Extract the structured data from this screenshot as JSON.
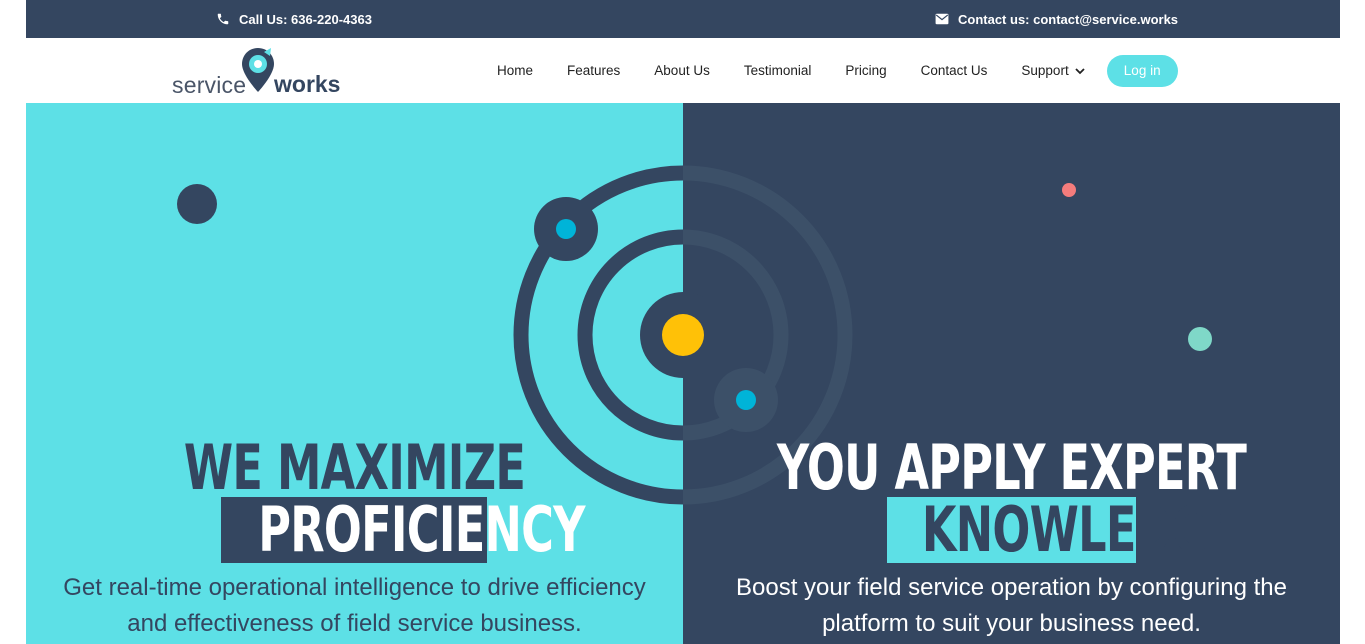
{
  "topbar": {
    "call_label": "Call Us: 636-220-4363",
    "contact_label": "Contact us: contact@service.works",
    "phone_icon": "phone-icon",
    "mail_icon": "envelope-icon"
  },
  "logo": {
    "word1": "service",
    "word2": "works",
    "icon": "map-pin-icon"
  },
  "nav": {
    "items": [
      {
        "label": "Home"
      },
      {
        "label": "Features"
      },
      {
        "label": "About Us"
      },
      {
        "label": "Testimonial"
      },
      {
        "label": "Pricing"
      },
      {
        "label": "Contact Us"
      },
      {
        "label": "Support"
      }
    ],
    "support_icon": "chevron-down-icon",
    "login_label": "Log in"
  },
  "hero": {
    "left": {
      "line1": "WE MAXIMIZE YOUR",
      "highlight": "PROFICIENCY",
      "subtitle_line1": "Get real-time operational intelligence to drive efficiency",
      "subtitle_line2": "and effectiveness of field service business."
    },
    "right": {
      "line1": "YOU APPLY EXPERT",
      "highlight": "KNOWLEDGE",
      "subtitle_line1": "Boost your field service operation by configuring the",
      "subtitle_line2": "platform to suit your business need."
    }
  },
  "colors": {
    "navy": "#344660",
    "cyan": "#5de0e6",
    "accent_blue": "#00b4d8",
    "sun_yellow": "#ffc107",
    "coral": "#f47c7c",
    "mint": "#7fd8c8"
  }
}
